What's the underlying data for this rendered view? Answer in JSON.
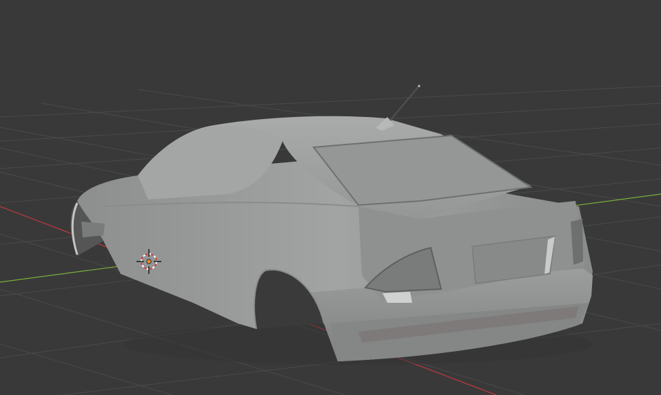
{
  "viewport": {
    "background": "#393939",
    "grid_color": "#4a4a4a",
    "x_axis_color": "#c8393f",
    "y_axis_color": "#7ab03a"
  },
  "model": {
    "body_color": "#9a9c9c",
    "object": "car-body-mesh"
  },
  "gizmo": {
    "icon": "3d-cursor-icon",
    "origin_color": "#f08a24"
  }
}
